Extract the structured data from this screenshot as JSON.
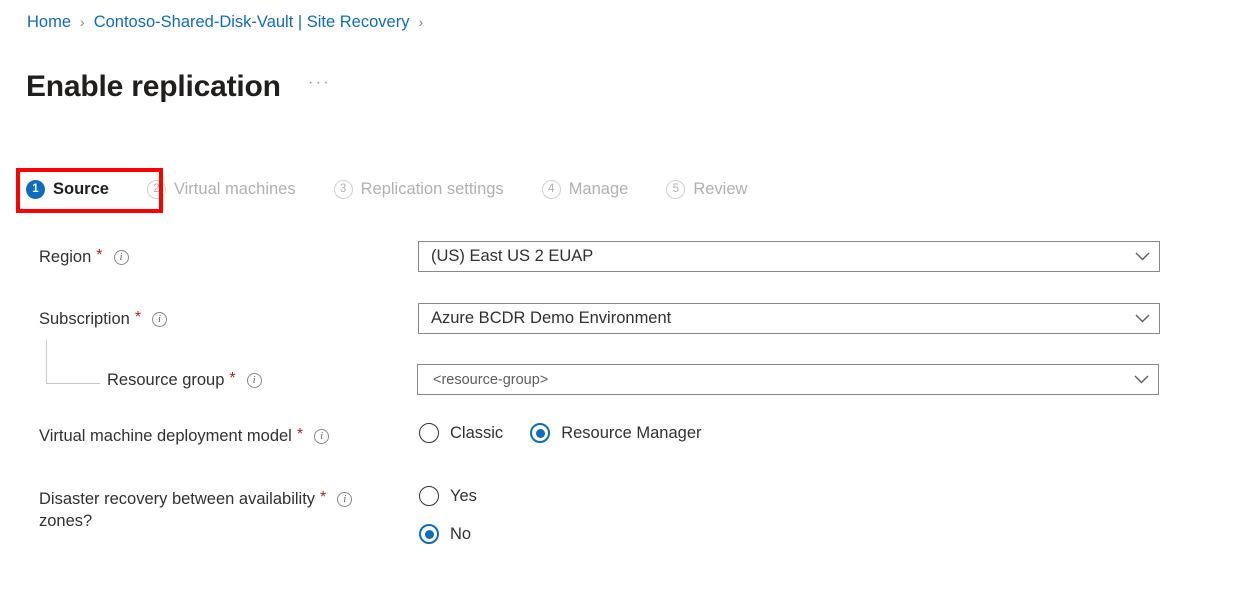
{
  "breadcrumb": {
    "separator": "›",
    "items": [
      {
        "label": "Home"
      },
      {
        "label": "Contoso-Shared-Disk-Vault | Site Recovery"
      }
    ]
  },
  "header": {
    "title": "Enable replication",
    "ellipsis": "···"
  },
  "wizard": {
    "tabs": [
      {
        "number": "1",
        "label": "Source",
        "state": "active"
      },
      {
        "number": "2",
        "label": "Virtual machines",
        "state": "inactive"
      },
      {
        "number": "3",
        "label": "Replication settings",
        "state": "inactive"
      },
      {
        "number": "4",
        "label": "Manage",
        "state": "inactive"
      },
      {
        "number": "5",
        "label": "Review",
        "state": "inactive"
      }
    ]
  },
  "form": {
    "required_marker": "*",
    "info_glyph": "i",
    "region": {
      "label": "Region",
      "value": "(US) East US 2 EUAP"
    },
    "subscription": {
      "label": "Subscription",
      "value": "Azure BCDR Demo Environment"
    },
    "resource_group": {
      "label": "Resource group",
      "value": "<resource-group>"
    },
    "deployment_model": {
      "label": "Virtual machine deployment model",
      "options": [
        {
          "label": "Classic",
          "selected": false
        },
        {
          "label": "Resource Manager",
          "selected": true
        }
      ]
    },
    "availability_zones": {
      "label": "Disaster recovery between availability\nzones?",
      "options": [
        {
          "label": "Yes",
          "selected": false
        },
        {
          "label": "No",
          "selected": true
        }
      ]
    }
  },
  "annotation": {
    "highlight_color": "#ff0000",
    "target": "Source"
  },
  "colors": {
    "accent_blue": "#0f6cbd",
    "link_blue": "#0f6cbd",
    "required_red": "#a4262c",
    "highlight_red": "#ff0000",
    "text_primary": "#323130",
    "text_disabled": "#b3b0ad",
    "border_gray": "#8a8886"
  }
}
